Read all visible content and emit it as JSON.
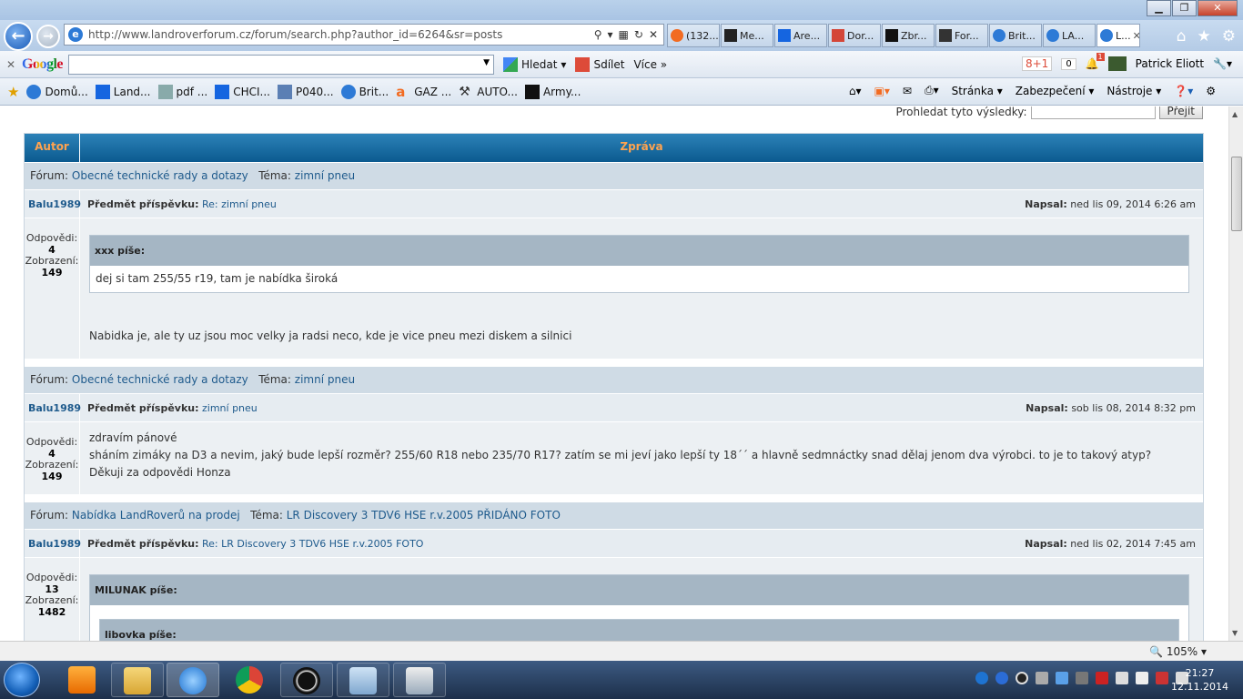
{
  "browser": {
    "url": "http://www.landroverforum.cz/forum/search.php?author_id=6264&sr=posts",
    "tabs": [
      "(132...",
      "Me...",
      "Are...",
      "Dor...",
      "Zbr...",
      "For...",
      "Brit...",
      "LA...",
      "L..."
    ],
    "window_buttons": {
      "minimize": "▁",
      "restore": "❐",
      "close": "✕"
    }
  },
  "google_toolbar": {
    "logo": "Google",
    "search_button": "Hledat",
    "share_button": "Sdílet",
    "more_button": "Více »",
    "plusone": "8+1",
    "plusone_count": "0",
    "notif_count": "1",
    "user": "Patrick Eliott"
  },
  "favorites": [
    "Domů...",
    "Land...",
    "pdf ...",
    "CHCI...",
    "P040...",
    "Brit...",
    "GAZ ...",
    "AUTO...",
    "Army..."
  ],
  "commandbar": {
    "page": "Stránka ▾",
    "security": "Zabezpečení ▾",
    "tools": "Nástroje ▾"
  },
  "page": {
    "search_results_label": "Prohledat tyto výsledky:",
    "search_button": "Přejít",
    "header_author": "Autor",
    "header_message": "Zpráva",
    "forum_label": "Fórum:",
    "topic_label": "Téma:",
    "subject_label": "Předmět příspěvku:",
    "posted_label": "Napsal:",
    "replies_label": "Odpovědi:",
    "views_label": "Zobrazení:",
    "posts": [
      {
        "forum": "Obecné technické rady a dotazy",
        "topic": "zimní pneu",
        "author": "Balu1989",
        "subject": "Re: zimní pneu",
        "date": "ned lis 09, 2014 6:26 am",
        "replies": "4",
        "views": "149",
        "quote_author": "xxx píše:",
        "quote_text": "dej si tam 255/55 r19, tam je nabídka široká",
        "text": "Nabidka je, ale ty uz jsou moc velky ja radsi neco, kde je vice pneu mezi diskem a silnici"
      },
      {
        "forum": "Obecné technické rady a dotazy",
        "topic": "zimní pneu",
        "author": "Balu1989",
        "subject": "zimní pneu",
        "date": "sob lis 08, 2014 8:32 pm",
        "replies": "4",
        "views": "149",
        "line1": "zdravím pánové",
        "line2": "sháním zimáky na D3 a nevim, jaký bude lepší rozměr? 255/60 R18 nebo 235/70 R17? zatím se mi jeví jako lepší ty 18´´ a hlavně sedmnáctky snad dělaj jenom dva výrobci. to je to takový atyp?",
        "line3": "Děkuji za odpovědi Honza"
      },
      {
        "forum": "Nabídka LandRoverů na prodej",
        "topic": "LR Discovery 3 TDV6 HSE r.v.2005 PŘIDÁNO FOTO",
        "author": "Balu1989",
        "subject": "Re: LR Discovery 3 TDV6 HSE r.v.2005 FOTO",
        "date": "ned lis 02, 2014 7:45 am",
        "replies": "13",
        "views": "1482",
        "quote_author": "MILUNAK píše:",
        "inner_quote_author": "libovka píše:"
      }
    ]
  },
  "statusbar": {
    "zoom": "105% ▾"
  },
  "taskbar": {
    "time": "21:27",
    "date": "12.11.2014"
  }
}
